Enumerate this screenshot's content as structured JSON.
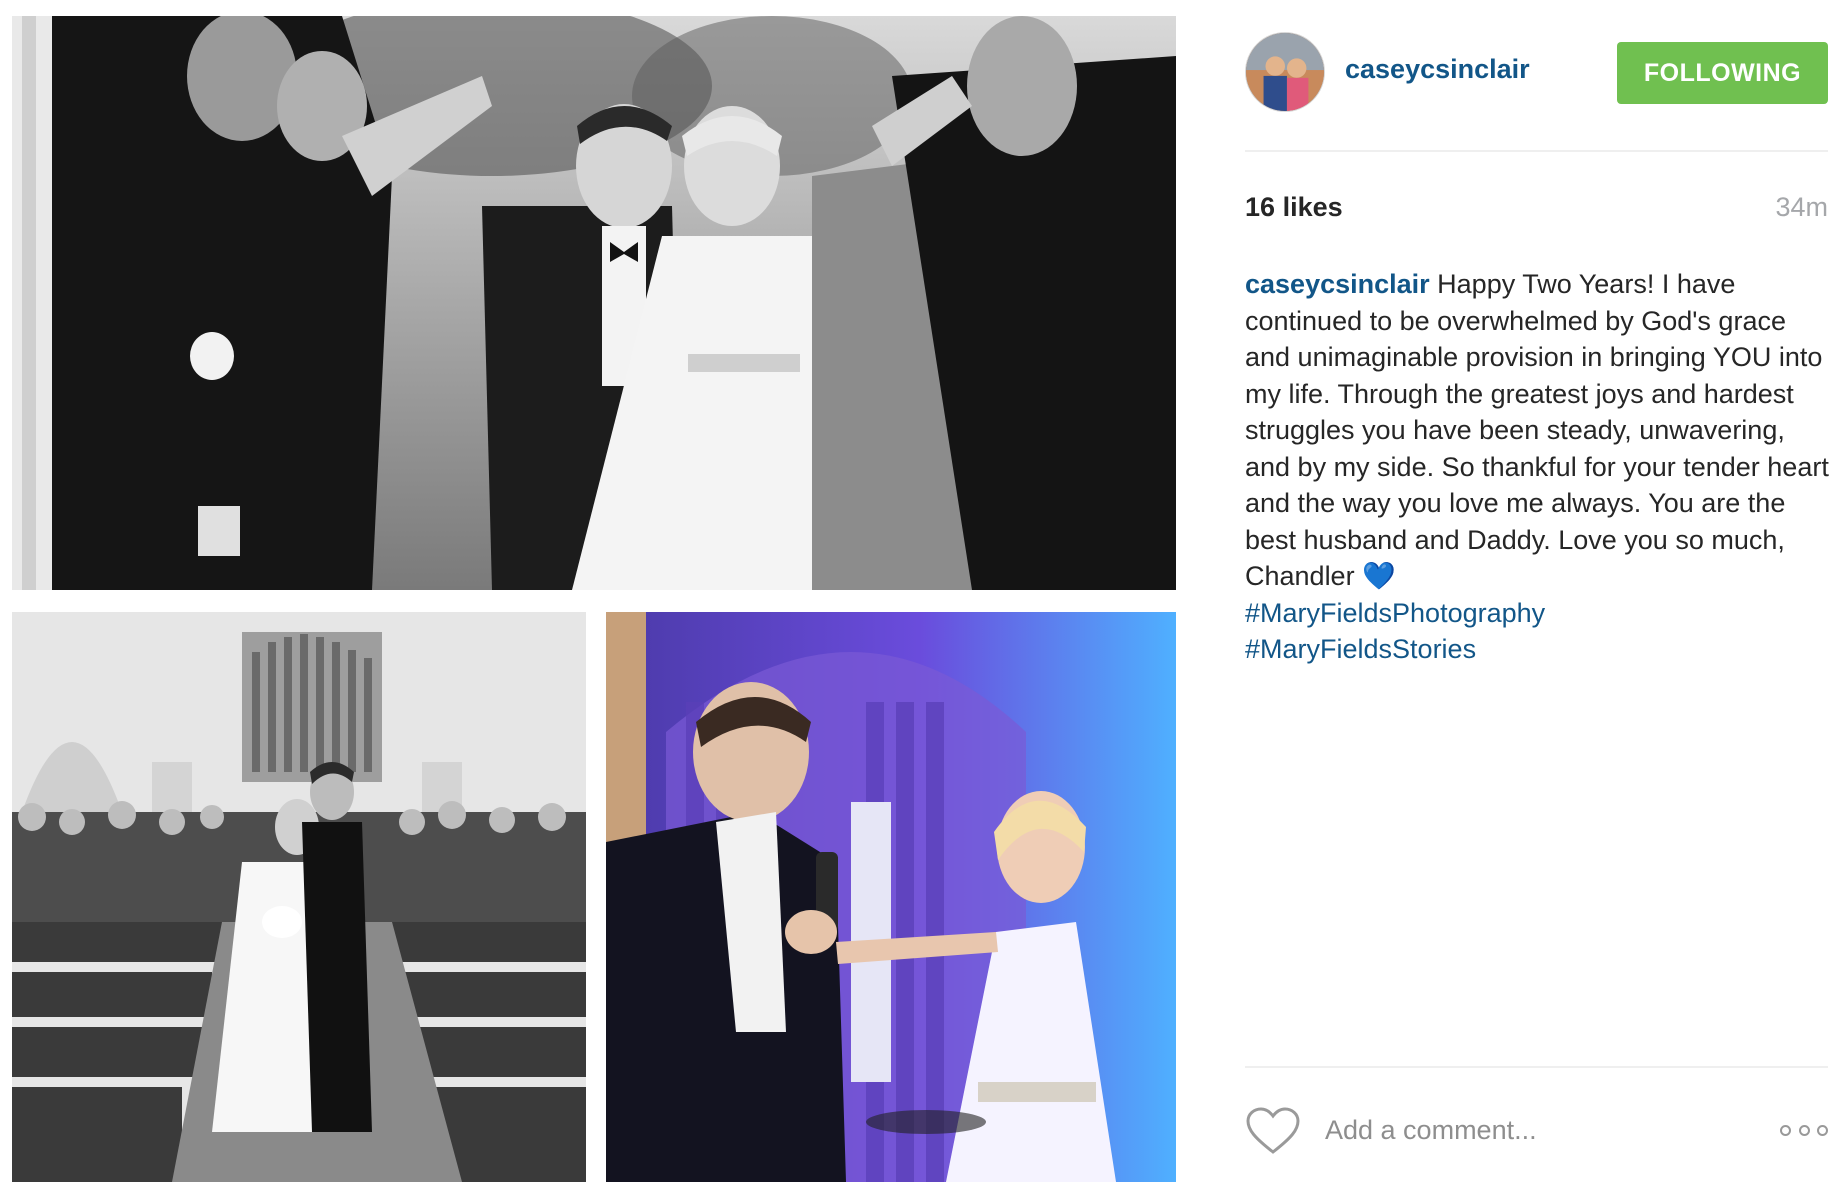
{
  "post": {
    "username": "caseycsinclair",
    "follow_button": "FOLLOWING",
    "likes_count": "16",
    "likes_label": "likes",
    "time_ago": "34m",
    "caption": {
      "username": "caseycsinclair",
      "text": "Happy Two Years! I have continued to be overwhelmed by God's grace and unimaginable provision in bringing YOU into my life. Through the greatest joys and hardest struggles you have been steady, unwavering, and by my side. So thankful for your tender heart and the way you love me always. You are the best husband and Daddy. Love you so much, Chandler",
      "emoji": "💙",
      "hashtags": [
        "#MaryFieldsPhotography",
        "#MaryFieldsStories"
      ]
    },
    "comment": {
      "placeholder": "Add a comment..."
    },
    "icons": {
      "like": "heart-outline-icon",
      "more": "more-options-icon"
    },
    "colors": {
      "username": "#125688",
      "follow_bg": "#70c050",
      "text": "#262626",
      "muted": "#a5a7aa"
    }
  }
}
